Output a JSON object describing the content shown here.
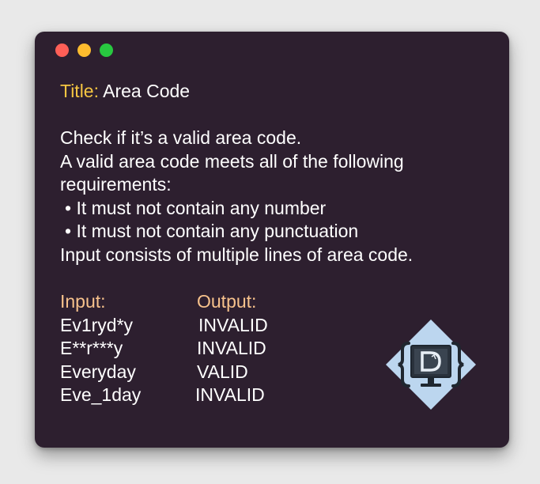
{
  "window": {
    "controls": [
      {
        "name": "close",
        "color": "#ff5f57"
      },
      {
        "name": "minimize",
        "color": "#febc2e"
      },
      {
        "name": "maximize",
        "color": "#28c840"
      }
    ]
  },
  "title": {
    "key": "Title:",
    "value": "Area Code"
  },
  "description": {
    "line1": "Check if it’s a valid area code.",
    "line2": "A valid area code meets all of the following",
    "line3": "requirements:",
    "bullet1": "• It must not contain any number",
    "bullet2": "• It must not contain any punctuation",
    "line4": "Input consists of multiple lines of area code."
  },
  "table": {
    "input_header": "Input:",
    "output_header": "Output:",
    "rows": [
      {
        "input": "Ev1ryd*y",
        "output": "INVALID"
      },
      {
        "input": "E**r***y",
        "output": "INVALID"
      },
      {
        "input": "Everyday",
        "output": "VALID"
      },
      {
        "input": "Eve_1day",
        "output": "INVALID"
      }
    ]
  },
  "logo": {
    "icon": "code-monitor-logo-icon",
    "colors": {
      "diamond": "#bcd6ef",
      "ink": "#1f2730"
    }
  }
}
